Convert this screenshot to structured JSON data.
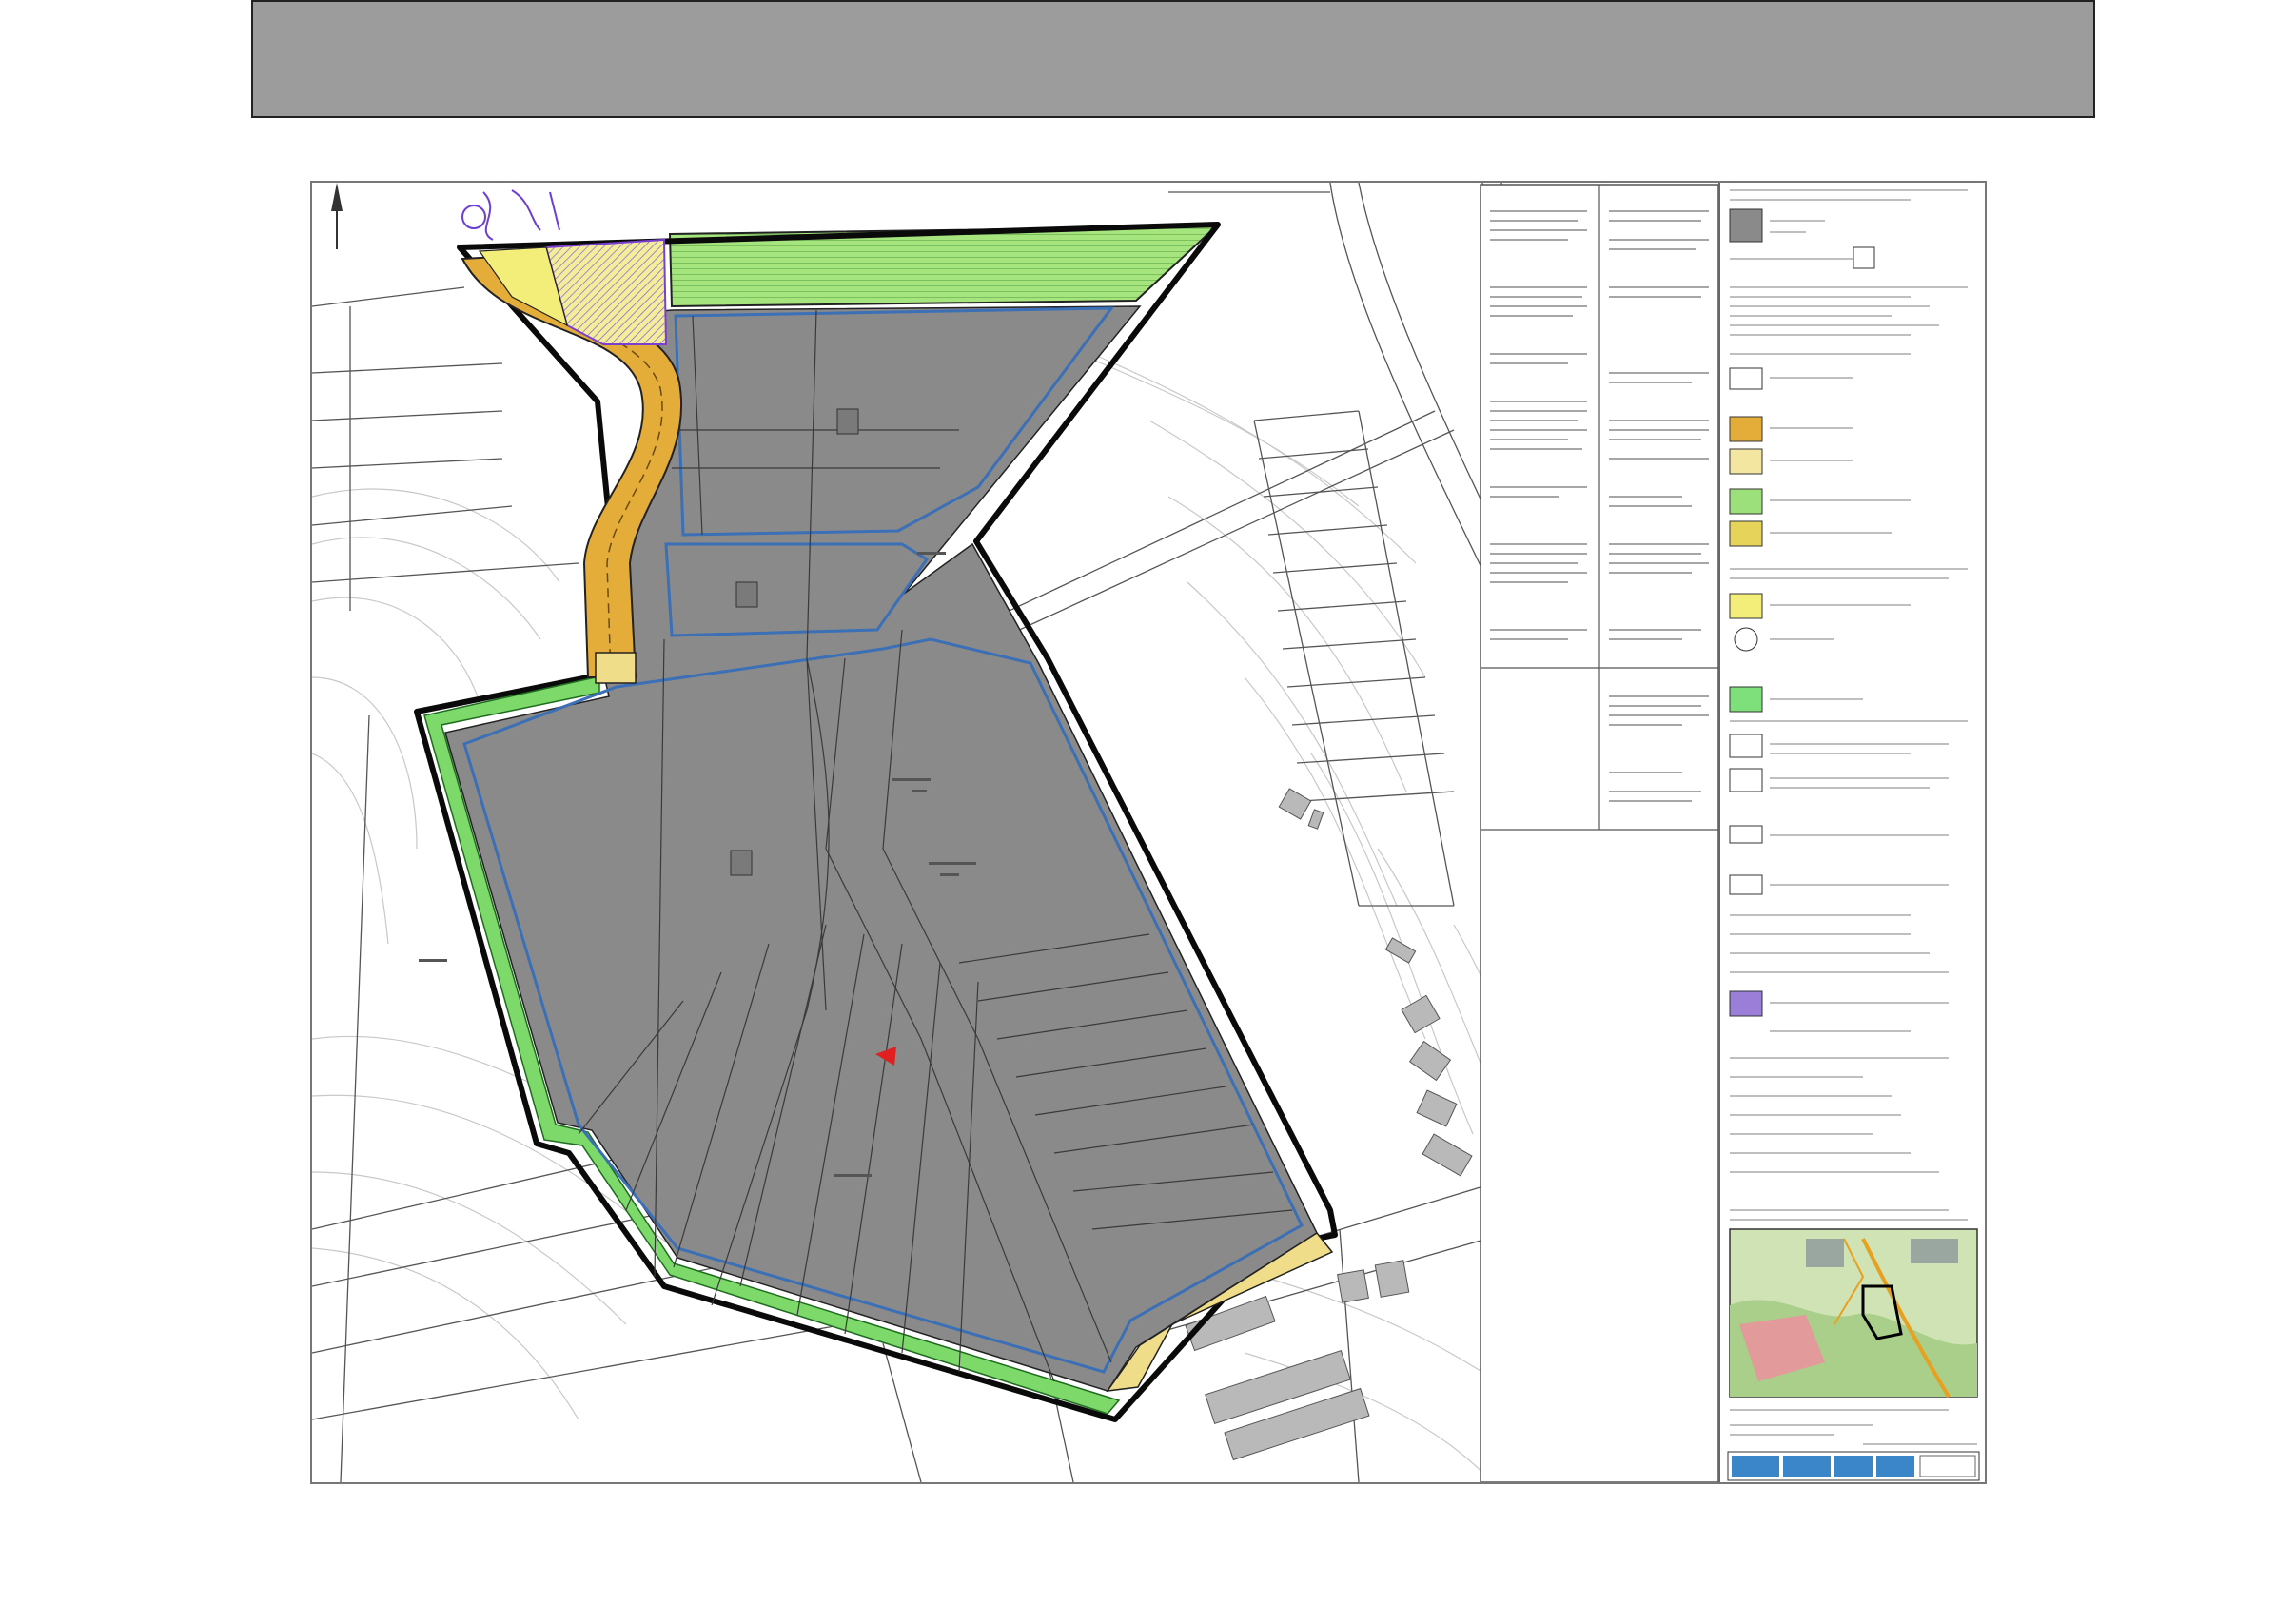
{
  "slide": {
    "title": ""
  },
  "plan": {
    "zone_labels": [],
    "legend_items": [
      {
        "icon": "grey-area-swatch",
        "color": "#8a8a8a"
      },
      {
        "icon": "blue-boundary-swatch",
        "color": "#3b6fb6"
      },
      {
        "icon": "orange-road-swatch",
        "color": "#e8b030"
      },
      {
        "icon": "light-yellow-swatch",
        "color": "#f2e6a0"
      },
      {
        "icon": "green-hatch-swatch",
        "color": "#9be07a"
      },
      {
        "icon": "yellow-hatch-swatch",
        "color": "#e6d45a"
      },
      {
        "icon": "yellow-area-swatch",
        "color": "#f3ee7a"
      },
      {
        "icon": "circle-symbol",
        "color": "#333333"
      },
      {
        "icon": "green-area-swatch",
        "color": "#7ee07a"
      },
      {
        "icon": "black-border-swatch",
        "color": "#000000"
      },
      {
        "icon": "purple-hatch-swatch",
        "color": "#9a7ed8"
      }
    ],
    "colors": {
      "development_area": "#8a8a8a",
      "boundary_line": "#3b6fb6",
      "green_strip": "#7cd96a",
      "green_hatch_area": "#a6e47e",
      "access_road": "#e4ad3a",
      "road_light": "#f0dd8a",
      "purple_marks": "#7a3fd0",
      "red_marker": "#e02020"
    }
  }
}
